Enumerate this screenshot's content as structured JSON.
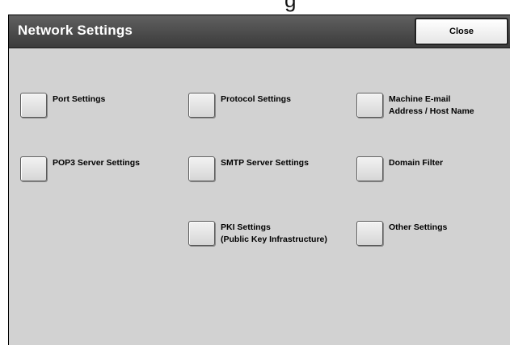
{
  "page_fragment": "g",
  "window": {
    "title": "Network Settings",
    "close_label": "Close"
  },
  "options": {
    "port_settings": "Port Settings",
    "protocol_settings": "Protocol Settings",
    "machine_email_line1": "Machine E-mail",
    "machine_email_line2": "Address / Host Name",
    "pop3_server_settings": "POP3 Server Settings",
    "smtp_server_settings": "SMTP Server Settings",
    "domain_filter": "Domain Filter",
    "pki_line1": "PKI Settings",
    "pki_line2": "(Public Key Infrastructure)",
    "other_settings": "Other Settings"
  },
  "colors": {
    "panel_background": "#d2d2d2",
    "title_bar": "#4a4a4a",
    "title_text": "#ffffff"
  }
}
